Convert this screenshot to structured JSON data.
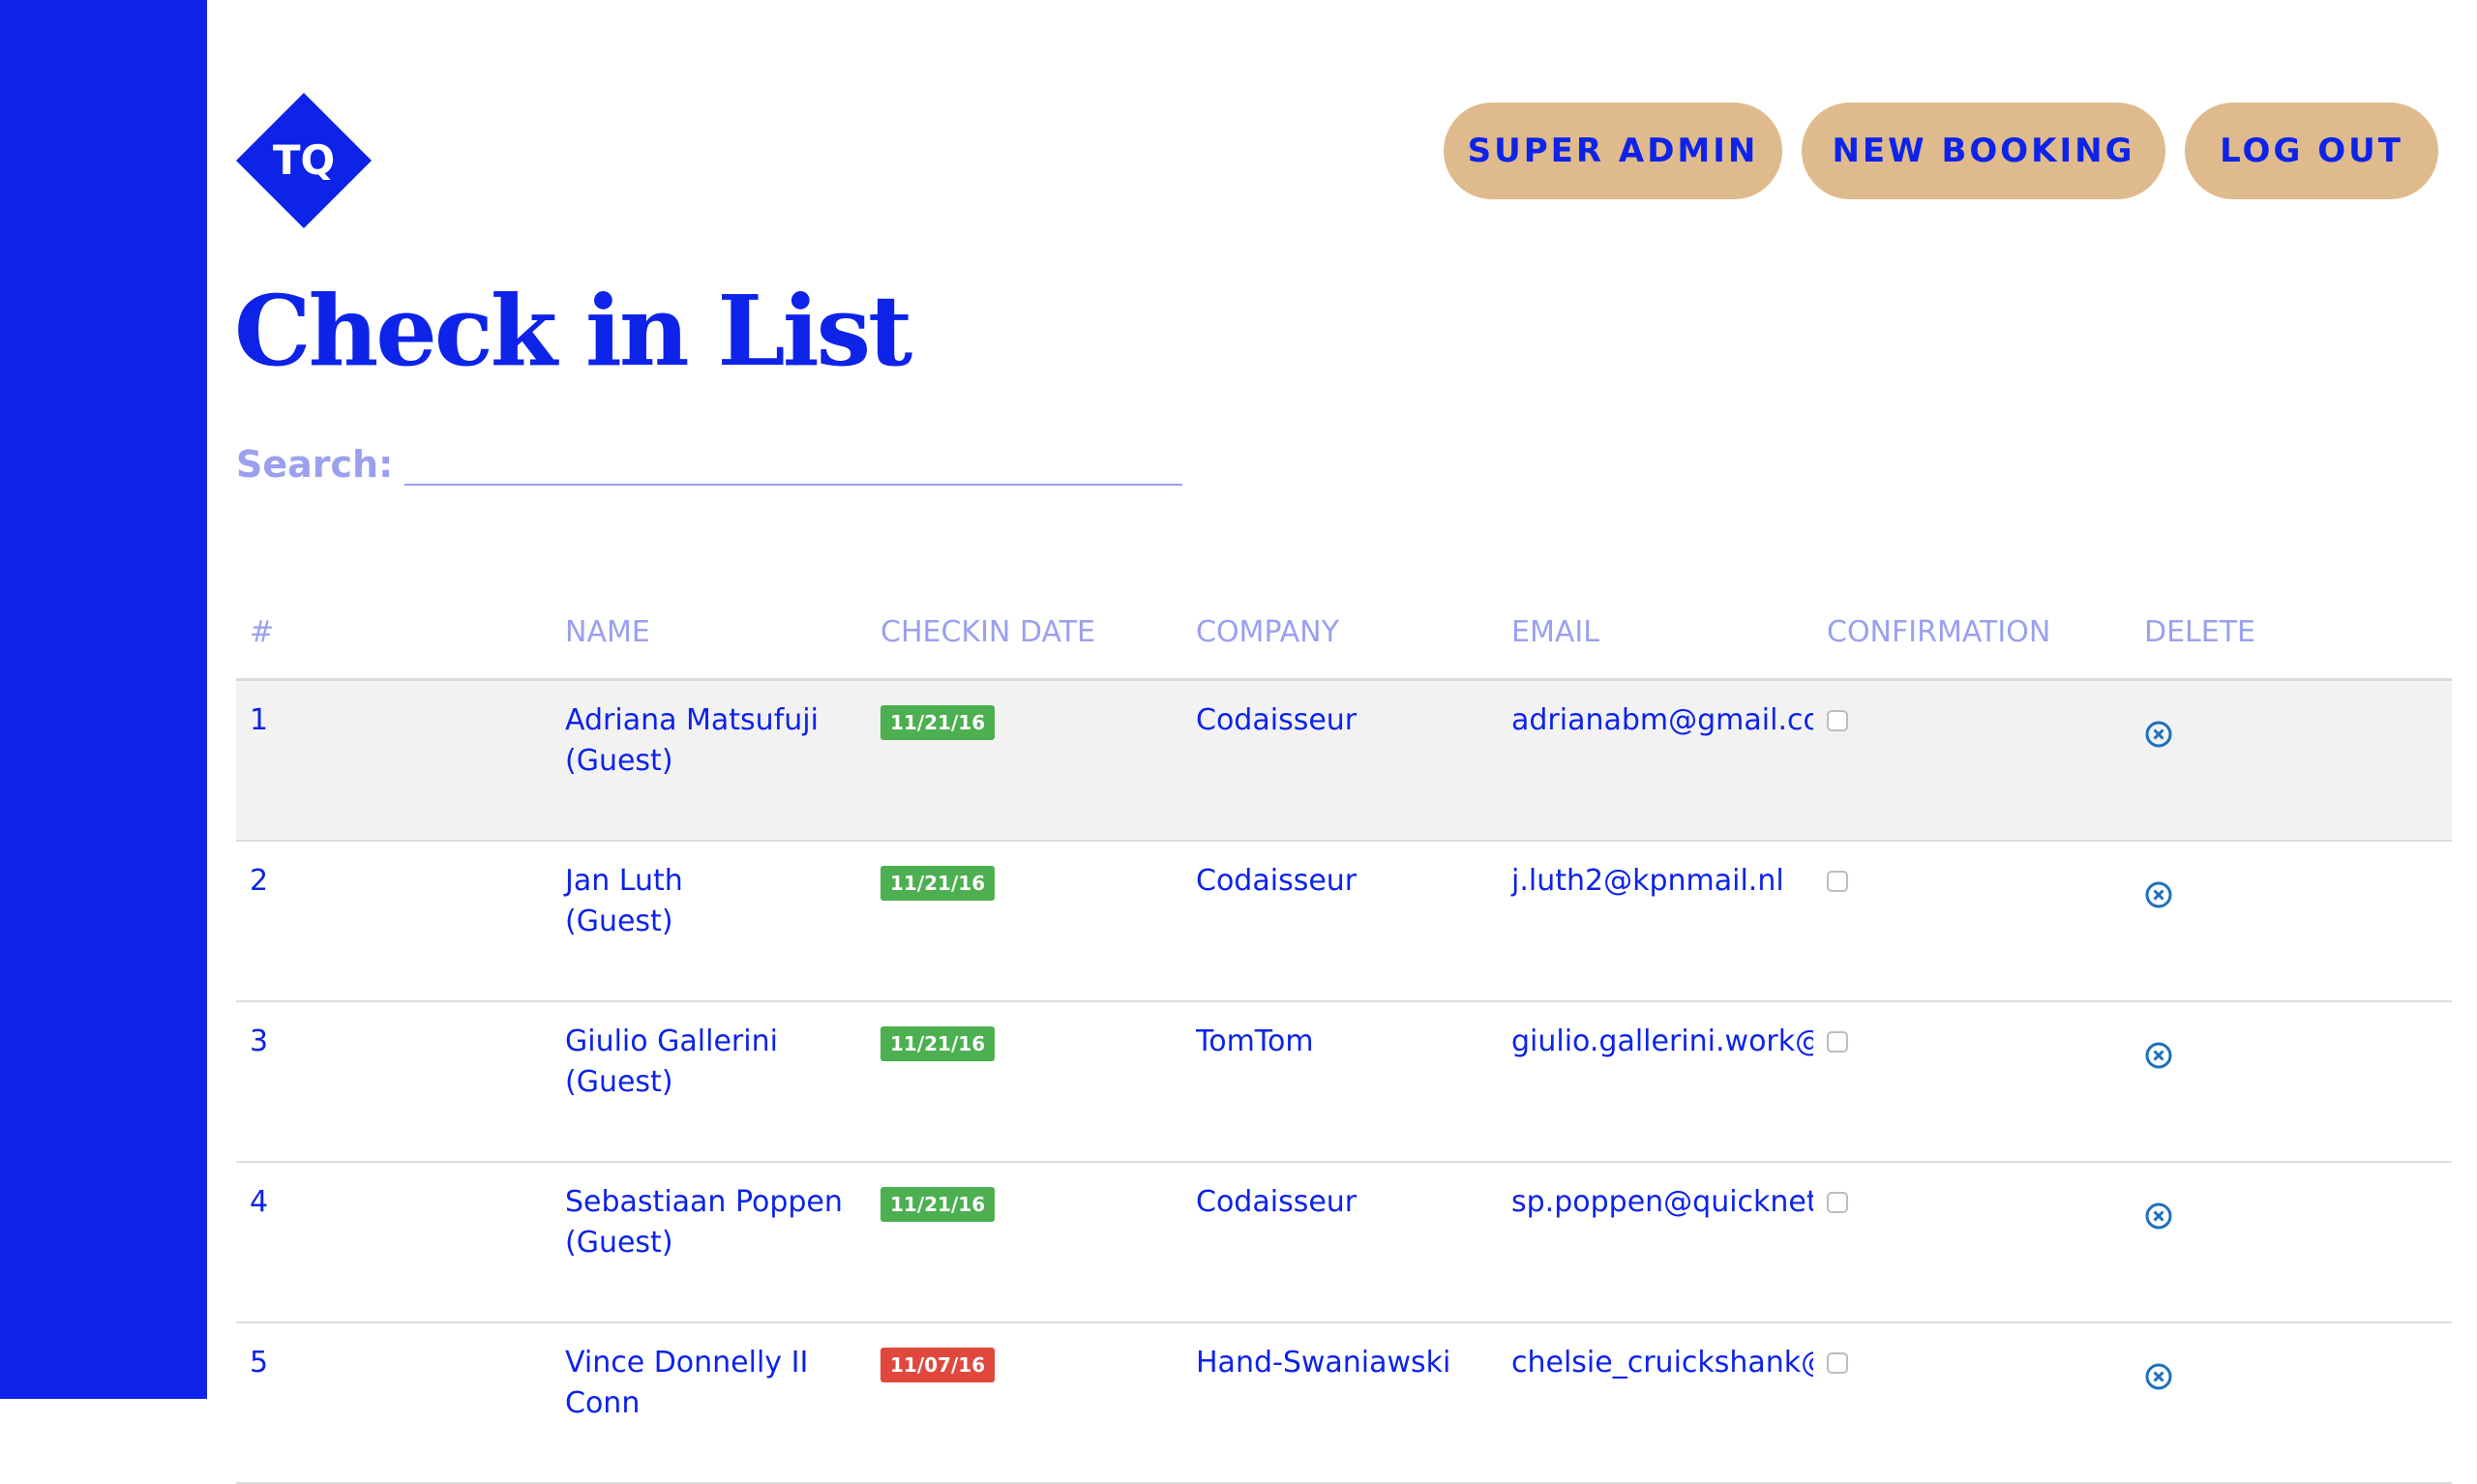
{
  "header": {
    "logo_text": "TQ",
    "buttons": {
      "super_admin": "SUPER ADMIN",
      "new_booking": "NEW BOOKING",
      "log_out": "LOG OUT"
    }
  },
  "main": {
    "title": "Check in List",
    "search": {
      "label": "Search:",
      "value": "",
      "placeholder": ""
    },
    "table": {
      "columns": [
        "#",
        "NAME",
        "CHECKIN DATE",
        "COMPANY",
        "EMAIL",
        "CONFIRMATION",
        "DELETE"
      ],
      "rows": [
        {
          "num": "1",
          "name": "Adriana Matsufuji",
          "role": "(Guest)",
          "date": "11/21/16",
          "date_status": "green",
          "company": "Codaisseur",
          "email": "adrianabm@gmail.com"
        },
        {
          "num": "2",
          "name": "Jan Luth",
          "role": "(Guest)",
          "date": "11/21/16",
          "date_status": "green",
          "company": "Codaisseur",
          "email": "j.luth2@kpnmail.nl"
        },
        {
          "num": "3",
          "name": "Giulio Gallerini",
          "role": "(Guest)",
          "date": "11/21/16",
          "date_status": "green",
          "company": "TomTom",
          "email": "giulio.gallerini.work@h"
        },
        {
          "num": "4",
          "name": "Sebastiaan Poppen",
          "role": "(Guest)",
          "date": "11/21/16",
          "date_status": "green",
          "company": "Codaisseur",
          "email": "sp.poppen@quicknet.n"
        },
        {
          "num": "5",
          "name": "Vince Donnelly II",
          "role": "Conn",
          "date": "11/07/16",
          "date_status": "red",
          "company": "Hand-Swaniawski",
          "email": "chelsie_cruickshank@"
        }
      ]
    }
  },
  "colors": {
    "brand_blue": "#0d23e8",
    "accent_tan": "#dfba8c",
    "muted_label": "#9aa0ef",
    "badge_green": "#4caf50",
    "badge_red": "#e0483d",
    "row_highlight": "#f2f2f2"
  },
  "icons": {
    "logo": "tq-diamond-logo",
    "delete": "circle-x-icon"
  }
}
